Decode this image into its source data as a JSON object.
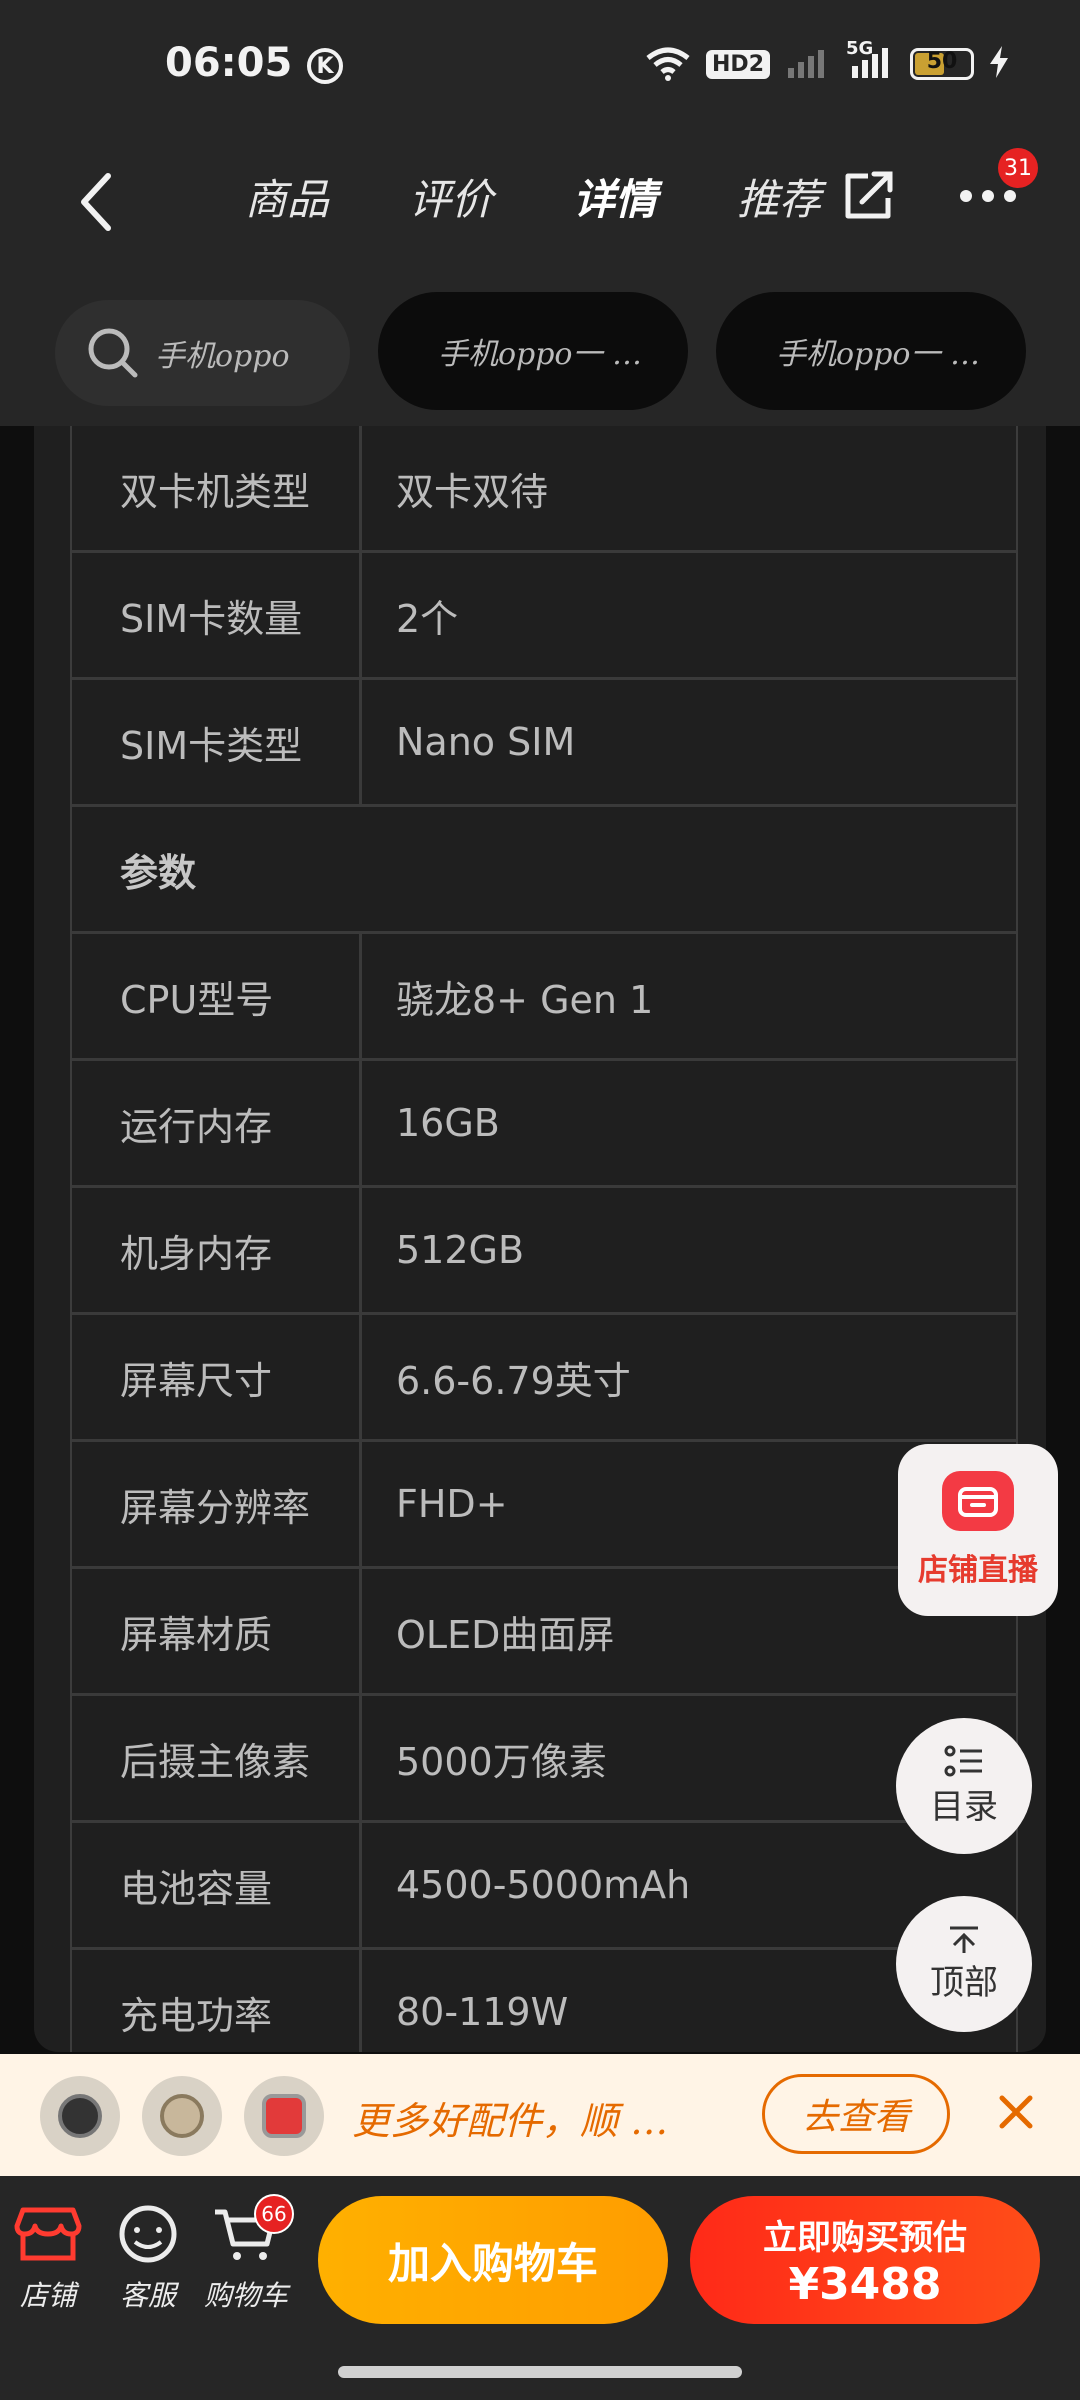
{
  "status_bar": {
    "time": "06:05",
    "network": "5G",
    "hd": "HD2",
    "battery": "50"
  },
  "nav": {
    "tabs": [
      {
        "label": "商品"
      },
      {
        "label": "评价"
      },
      {
        "label": "详情"
      },
      {
        "label": "推荐"
      }
    ],
    "more_badge": "31"
  },
  "search": {
    "placeholder": "手机oppo",
    "chips": [
      "手机oppo一 …",
      "手机oppo一 …"
    ]
  },
  "spec_table": [
    {
      "key": "双卡机类型",
      "value": "双卡双待"
    },
    {
      "key": "SIM卡数量",
      "value": "2个"
    },
    {
      "key": "SIM卡类型",
      "value": "Nano SIM"
    },
    {
      "section": "参数"
    },
    {
      "key": "CPU型号",
      "value": "骁龙8+ Gen 1"
    },
    {
      "key": "运行内存",
      "value": "16GB"
    },
    {
      "key": "机身内存",
      "value": "512GB"
    },
    {
      "key": "屏幕尺寸",
      "value": "6.6-6.79英寸"
    },
    {
      "key": "屏幕分辨率",
      "value": "FHD+"
    },
    {
      "key": "屏幕材质",
      "value": "OLED曲面屏"
    },
    {
      "key": "后摄主像素",
      "value": "5000万像素"
    },
    {
      "key": "电池容量",
      "value": "4500-5000mAh"
    },
    {
      "key": "充电功率",
      "value": "80-119W"
    }
  ],
  "floating": {
    "live_label": "店铺直播",
    "toc_label": "目录",
    "top_label": "顶部"
  },
  "promo": {
    "text": "更多好配件，顺 …",
    "button": "去查看"
  },
  "bottom_bar": {
    "store_label": "店铺",
    "service_label": "客服",
    "cart_label": "购物车",
    "cart_badge": "66",
    "add_cart": "加入购物车",
    "buy_line1": "立即购买预估",
    "buy_price": "¥3488"
  },
  "colors": {
    "accent_orange": "#ff9d00",
    "accent_red": "#ff2a18",
    "promo_text": "#e56a00"
  }
}
